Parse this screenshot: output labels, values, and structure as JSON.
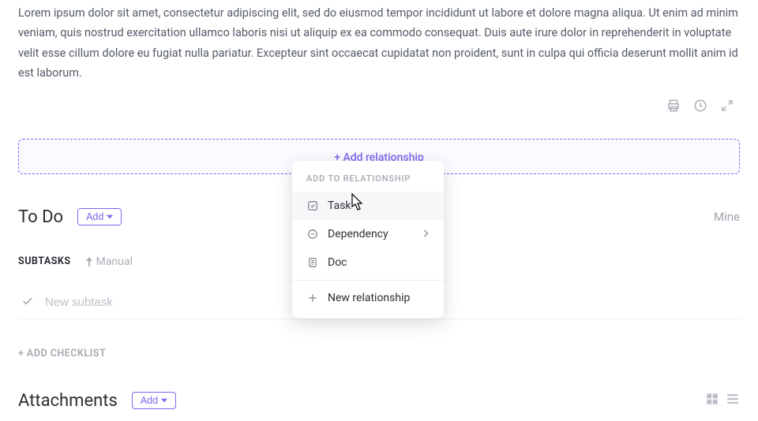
{
  "description": "Lorem ipsum dolor sit amet, consectetur adipiscing elit, sed do eiusmod tempor incididunt ut labore et dolore magna aliqua. Ut enim ad minim veniam, quis nostrud exercitation ullamco laboris nisi ut aliquip ex ea commodo consequat. Duis aute irure dolor in reprehenderit in voluptate velit esse cillum dolore eu fugiat nulla pariatur. Excepteur sint occaecat cupidatat non proident, sunt in culpa qui officia deserunt mollit anim id est laborum.",
  "relationship": {
    "add_label": "+ Add relationship"
  },
  "todo": {
    "title": "To Do",
    "add_label": "Add",
    "mine_label": "Mine"
  },
  "subtasks": {
    "label": "SUBTASKS",
    "manual_label": "Manual",
    "new_placeholder": "New subtask"
  },
  "checklist": {
    "add_label": "+ ADD CHECKLIST"
  },
  "attachments": {
    "title": "Attachments",
    "add_label": "Add"
  },
  "dropdown": {
    "header": "ADD TO RELATIONSHIP",
    "items": {
      "task": "Task",
      "dependency": "Dependency",
      "doc": "Doc",
      "new_relationship": "New relationship"
    }
  }
}
